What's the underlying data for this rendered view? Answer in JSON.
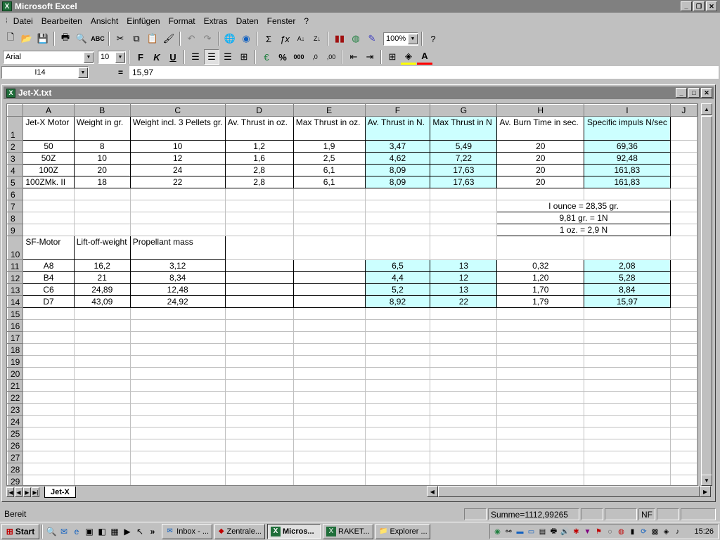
{
  "app": {
    "title": "Microsoft Excel"
  },
  "menu": [
    "Datei",
    "Bearbeiten",
    "Ansicht",
    "Einfügen",
    "Format",
    "Extras",
    "Daten",
    "Fenster",
    "?"
  ],
  "toolbar1": {
    "zoom": "100%"
  },
  "toolbar2": {
    "font": "Arial",
    "size": "10",
    "bold": "F",
    "italic": "K",
    "underline": "U"
  },
  "formula_bar": {
    "cell_ref": "I14",
    "equals": "=",
    "value": "15,97"
  },
  "workbook": {
    "title": "Jet-X.txt",
    "sheet_tab": "Jet-X"
  },
  "grid": {
    "columns": [
      "A",
      "B",
      "C",
      "D",
      "E",
      "F",
      "G",
      "H",
      "I",
      "J"
    ],
    "row1": [
      "Jet-X Motor",
      "Weight in gr.",
      "Weight incl. 3 Pellets gr.",
      "Av. Thrust in oz.",
      "Max Thrust in oz.",
      "Av. Thrust in N.",
      "Max Thrust in N",
      "Av. Burn Time in sec.",
      "Specific impuls N/sec",
      ""
    ],
    "row2": [
      "50",
      "8",
      "10",
      "1,2",
      "1,9",
      "3,47",
      "5,49",
      "20",
      "69,36",
      ""
    ],
    "row3": [
      "50Z",
      "10",
      "12",
      "1,6",
      "2,5",
      "4,62",
      "7,22",
      "20",
      "92,48",
      ""
    ],
    "row4": [
      "100Z",
      "20",
      "24",
      "2,8",
      "6,1",
      "8,09",
      "17,63",
      "20",
      "161,83",
      ""
    ],
    "row5": [
      "100ZMk. II",
      "18",
      "22",
      "2,8",
      "6,1",
      "8,09",
      "17,63",
      "20",
      "161,83",
      ""
    ],
    "note1": "I ounce = 28,35 gr.",
    "note2": "9,81 gr. = 1N",
    "note3": "1 oz. = 2,9 N",
    "row10": [
      "SF-Motor",
      "Lift-off-weight",
      "Propellant mass",
      "",
      "",
      "",
      "",
      "",
      "",
      ""
    ],
    "row11": [
      "A8",
      "16,2",
      "3,12",
      "",
      "",
      "6,5",
      "13",
      "0,32",
      "2,08",
      ""
    ],
    "row12": [
      "B4",
      "21",
      "8,34",
      "",
      "",
      "4,4",
      "12",
      "1,20",
      "5,28",
      ""
    ],
    "row13": [
      "C6",
      "24,89",
      "12,48",
      "",
      "",
      "5,2",
      "13",
      "1,70",
      "8,84",
      ""
    ],
    "row14": [
      "D7",
      "43,09",
      "24,92",
      "",
      "",
      "8,92",
      "22",
      "1,79",
      "15,97",
      ""
    ],
    "row_numbers": [
      "1",
      "2",
      "3",
      "4",
      "5",
      "6",
      "7",
      "8",
      "9",
      "10",
      "11",
      "12",
      "13",
      "14",
      "15",
      "16",
      "17",
      "18",
      "19",
      "20",
      "21",
      "22",
      "23",
      "24",
      "25",
      "26",
      "27",
      "28",
      "29"
    ]
  },
  "status": {
    "text": "Bereit",
    "sum": "Summe=1112,99265",
    "nf": "NF"
  },
  "taskbar": {
    "start": "Start",
    "tasks": [
      "Inbox - ...",
      "Zentrale...",
      "Micros...",
      "RAKET...",
      "Explorer ..."
    ],
    "more": "»",
    "clock": "15:26"
  }
}
